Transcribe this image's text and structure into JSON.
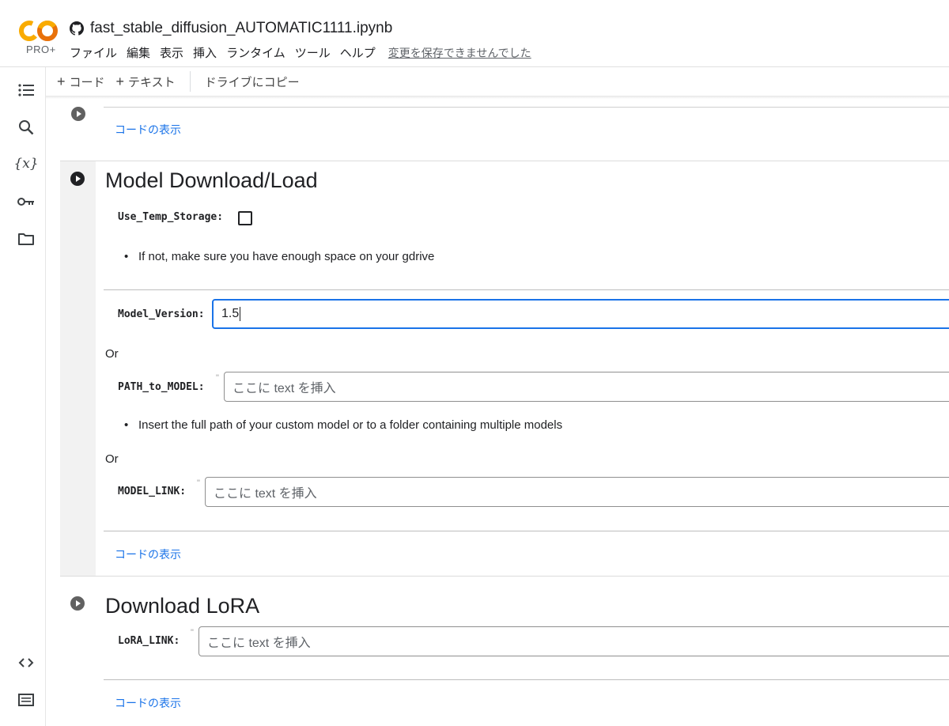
{
  "header": {
    "logo_text": "CO",
    "plan_badge": "PRO+",
    "notebook_title": "fast_stable_diffusion_AUTOMATIC1111.ipynb",
    "menu": [
      "ファイル",
      "編集",
      "表示",
      "挿入",
      "ランタイム",
      "ツール",
      "ヘルプ"
    ],
    "unsaved_notice": "変更を保存できませんでした"
  },
  "toolbar": {
    "add_code_label": "コード",
    "add_text_label": "テキスト",
    "copy_to_drive_label": "ドライブにコピー"
  },
  "rail": {
    "icons": [
      "table-of-contents-icon",
      "search-icon",
      "variables-icon",
      "secrets-key-icon",
      "files-folder-icon",
      "code-snippets-icon",
      "command-palette-icon"
    ]
  },
  "cells": {
    "prev_cell": {
      "show_code": "コードの表示"
    },
    "model_cell": {
      "title": "Model Download/Load",
      "use_temp_storage_label": "Use_Temp_Storage:",
      "use_temp_storage_checked": false,
      "temp_note": "If not, make sure you have enough space on your gdrive",
      "model_version_label": "Model_Version:",
      "model_version_value": "1.5",
      "or_1": "Or",
      "path_label": "PATH_to_MODEL:",
      "path_placeholder": "ここに text を挿入",
      "path_note": "Insert the full path of your custom model or to a folder containing multiple models",
      "or_2": "Or",
      "link_label": "MODEL_LINK:",
      "link_placeholder": "ここに text を挿入",
      "show_code": "コードの表示"
    },
    "lora_cell": {
      "title": "Download LoRA",
      "link_label": "LoRA_LINK:",
      "link_placeholder": "ここに text を挿入",
      "show_code": "コードの表示"
    }
  },
  "colors": {
    "logo_orange": "#f9ab00",
    "logo_dark_orange": "#e8710a",
    "link_blue": "#1a73e8",
    "focus_blue": "#1a73e8"
  }
}
